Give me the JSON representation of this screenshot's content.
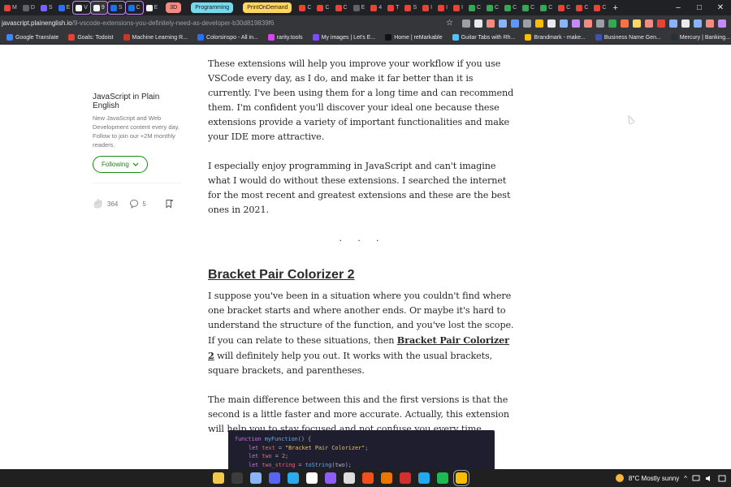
{
  "browser": {
    "tabs": [
      {
        "label": "M",
        "color": "#ea4335"
      },
      {
        "label": "D",
        "color": "#5f6368"
      },
      {
        "label": "S",
        "color": "#7b61ff"
      },
      {
        "label": "E",
        "color": "#2b6ff2"
      },
      {
        "label": "V",
        "color": "#f5f5f5"
      },
      {
        "label": "9",
        "color": "#f5f5f5",
        "active": true
      },
      {
        "label": "S",
        "color": "#1a73e8"
      },
      {
        "label": "C",
        "color": "#1a73e8"
      },
      {
        "label": "E",
        "color": "#f5f5f5"
      }
    ],
    "groups": [
      {
        "label": "3D",
        "color": "#f28b82"
      },
      {
        "label": "Programming",
        "color": "#78d9ec"
      },
      {
        "label": "PrintOnDemand",
        "color": "#fdd663"
      }
    ],
    "grouped_tabs": [
      "C",
      "C",
      "C",
      "E",
      "4",
      "T",
      "S",
      "I",
      "I",
      "I",
      "C",
      "C",
      "C",
      "C",
      "C",
      "C",
      "C",
      "C"
    ],
    "new_tab": "+",
    "url_host": "javascript.plainenglish.io",
    "url_path": "/9-vscode-extensions-you-definitely-need-as-developer-b30d819839f6",
    "star": "☆",
    "window_controls": [
      "–",
      "□",
      "✕"
    ],
    "bookmarks": [
      {
        "label": "Google Translate",
        "color": "#4285f4"
      },
      {
        "label": "Goals: Todoist",
        "color": "#e44332"
      },
      {
        "label": "Machine Learning R...",
        "color": "#c53929"
      },
      {
        "label": "Colorsinspo - All in...",
        "color": "#2b6ff2"
      },
      {
        "label": "rarity.tools",
        "color": "#e040fb"
      },
      {
        "label": "My images | Let's E...",
        "color": "#7c4dff"
      },
      {
        "label": "Home | reMarkable",
        "color": "#111111"
      },
      {
        "label": "Guitar Tabs with Rh...",
        "color": "#4fc3f7"
      },
      {
        "label": "Brandmark - make...",
        "color": "#fbbc04"
      },
      {
        "label": "Business Name Gen...",
        "color": "#3f51b5"
      },
      {
        "label": "Mercury | Banking...",
        "color": "#263238"
      }
    ]
  },
  "sidebar": {
    "publication": "JavaScript in Plain English",
    "description": "New JavaScript and Web Development content every day. Follow to join our +2M monthly readers.",
    "follow_label": "Following",
    "claps": "364",
    "responses": "5"
  },
  "article": {
    "para1": "These extensions will help you improve your workflow if you use VSCode every day, as I do, and make it far better than it is currently. I've been using them for a long time and can recommend them. I'm confident you'll discover your ideal one because these extensions provide a variety of important functionalities and make your IDE more attractive.",
    "para2": "I especially enjoy programming in JavaScript and can't imagine what I would do without these extensions. I searched the internet for the most recent and greatest extensions and these are the best ones in 2021.",
    "separator": ". . .",
    "heading": "Bracket Pair Colorizer 2",
    "para3_before": "I suppose you've been in a situation where you couldn't find where one bracket starts and where another ends. Or maybe it's hard to understand the structure of the function, and you've lost the scope. If you can relate to these situations, then ",
    "para3_link": "Bracket Pair Colorizer 2",
    "para3_after": " will definitely help you out. It works with the usual brackets, square brackets, and parentheses.",
    "para4": "The main difference between this and the first versions is that the second is a little faster and more accurate. Actually, this extension will help you to stay focused and not confuse you every time.",
    "code": {
      "l1_kw": "function",
      "l1_fn": "myFunction",
      "l1_rest": "() {",
      "l2_kw": "let",
      "l2_var": "text",
      "l2_eq": " = ",
      "l2_str": "\"Bracket Pair Colorizer\"",
      "l2_end": ";",
      "l3_kw": "let",
      "l3_var": "two",
      "l3_eq": " = ",
      "l3_num": "2",
      "l3_end": ";",
      "l4_kw": "let",
      "l4_var": "two_string",
      "l4_eq": " = ",
      "l4_fn": "toString",
      "l4_rest": "(two);"
    }
  },
  "taskbar": {
    "icons": [
      {
        "name": "file-explorer-icon",
        "color": "#f2c94c"
      },
      {
        "name": "terminal-icon",
        "color": "#3c3c3c"
      },
      {
        "name": "chrome-alt-icon",
        "color": "#8ab4f8"
      },
      {
        "name": "discord-icon",
        "color": "#5865f2"
      },
      {
        "name": "telegram-icon",
        "color": "#2aabee"
      },
      {
        "name": "notion-icon",
        "color": "#ffffff"
      },
      {
        "name": "obsidian-icon",
        "color": "#8e5cf7"
      },
      {
        "name": "notes-icon",
        "color": "#dddddd"
      },
      {
        "name": "figma-icon",
        "color": "#f24e1e"
      },
      {
        "name": "blender-icon",
        "color": "#ea7600"
      },
      {
        "name": "acrobat-icon",
        "color": "#d32f2f"
      },
      {
        "name": "vscode-icon",
        "color": "#23a9f2"
      },
      {
        "name": "spotify-icon",
        "color": "#1db954"
      },
      {
        "name": "chrome-icon",
        "color": "#fbbc04",
        "active": true
      }
    ],
    "weather": "8°C  Mostly sunny",
    "tray_chevron": "^"
  }
}
